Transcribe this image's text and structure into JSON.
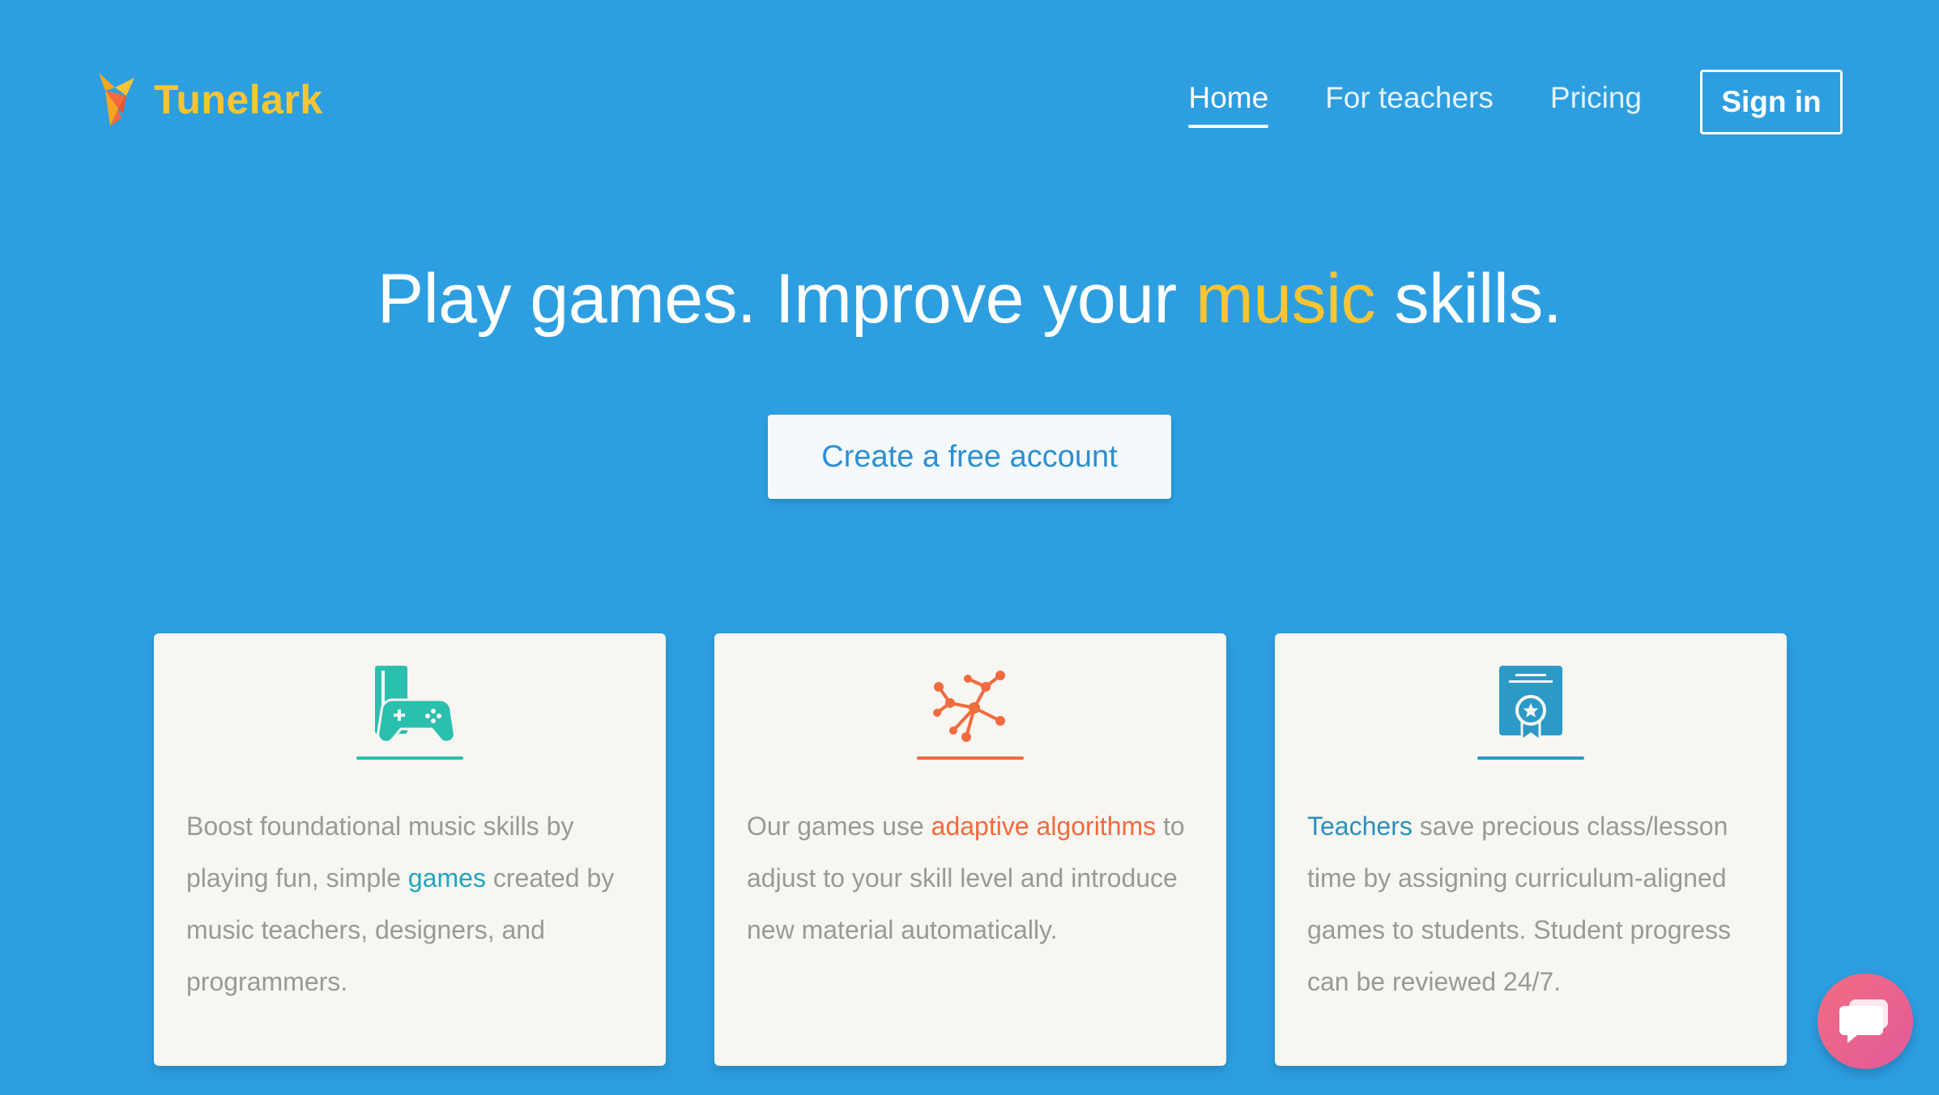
{
  "header": {
    "logo_text": "Tunelark",
    "nav": [
      {
        "label": "Home",
        "active": true
      },
      {
        "label": "For teachers",
        "active": false
      },
      {
        "label": "Pricing",
        "active": false
      }
    ],
    "signin_label": "Sign in"
  },
  "hero": {
    "title_before": "Play games. Improve your ",
    "title_highlight": "music",
    "title_after": " skills.",
    "cta_label": "Create a free account"
  },
  "cards": [
    {
      "icon": "game-console-icon",
      "color": "#2bbfae",
      "text_before": "Boost foundational music skills by playing fun, simple ",
      "highlight": "games",
      "text_after": " created by music teachers, designers, and programmers."
    },
    {
      "icon": "network-nodes-icon",
      "color": "#f26a3e",
      "text_before": "Our games use ",
      "highlight": "adaptive algorithms",
      "text_after": " to adjust to your skill level and introduce new material automatically."
    },
    {
      "icon": "certificate-icon",
      "color": "#2b9ac7",
      "text_before": "",
      "highlight": "Teachers",
      "text_after": " save precious class/lesson time by assigning curriculum-aligned games to students. Student progress can be reviewed 24/7."
    }
  ],
  "colors": {
    "background": "#2d9fe1",
    "accent_yellow": "#fbc433",
    "card_bg": "#f7f6f1"
  },
  "chat": {
    "icon": "chat-bubble-icon"
  }
}
